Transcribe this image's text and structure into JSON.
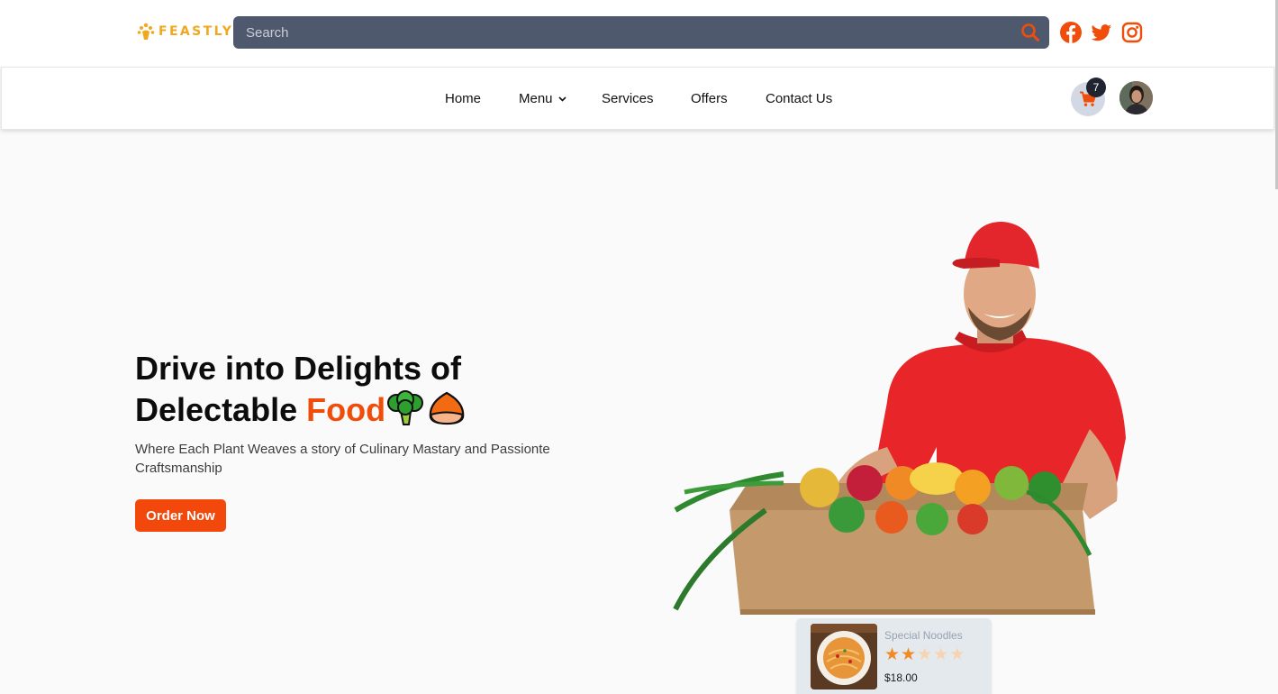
{
  "brand": {
    "name": "FEASTLY",
    "color": "#f0a91e"
  },
  "search": {
    "placeholder": "Search"
  },
  "social": [
    {
      "icon": "facebook-icon"
    },
    {
      "icon": "twitter-icon"
    },
    {
      "icon": "instagram-icon"
    }
  ],
  "nav": {
    "items": [
      {
        "label": "Home"
      },
      {
        "label": "Menu"
      },
      {
        "label": "Services"
      },
      {
        "label": "Offers"
      },
      {
        "label": "Contact Us"
      }
    ],
    "cart_count": "7"
  },
  "hero": {
    "title_line1": "Drive into Delights of",
    "title_line2_plain": "Delectable",
    "title_line2_accent": "Food",
    "subtitle": "Where Each Plant Weaves a story of Culinary Mastary and Passionte Craftsmanship",
    "cta": "Order Now"
  },
  "product_card": {
    "name": "Special Noodles",
    "rating": 2,
    "rating_max": 5,
    "price": "$18.00"
  },
  "colors": {
    "accent": "#f04d0b",
    "search_bg": "#4e596d",
    "cart_bg": "#d3d9e4"
  }
}
